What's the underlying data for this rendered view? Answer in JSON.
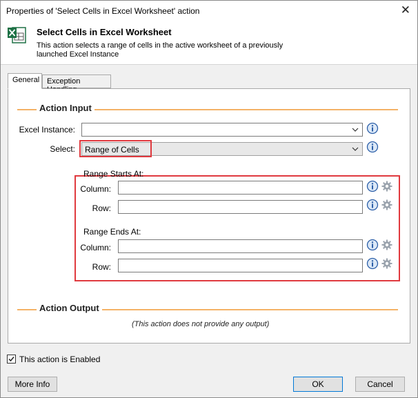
{
  "window": {
    "title": "Properties of 'Select Cells in Excel Worksheet' action",
    "close_glyph": "✕"
  },
  "header": {
    "icon": "excel-icon",
    "title": "Select Cells in Excel Worksheet",
    "description": "This action selects a range of cells in the active worksheet of a previously launched Excel Instance"
  },
  "tabs": [
    {
      "label": "General",
      "active": true
    },
    {
      "label": "Exception Handling",
      "active": false
    }
  ],
  "action_input": {
    "section_title": "Action Input",
    "excel_instance": {
      "label": "Excel Instance:",
      "value": ""
    },
    "select": {
      "label": "Select:",
      "value": "Range of Cells"
    },
    "range_start": {
      "label": "Range Starts At:",
      "column": {
        "label": "Column:",
        "value": ""
      },
      "row": {
        "label": "Row:",
        "value": ""
      }
    },
    "range_end": {
      "label": "Range Ends At:",
      "column": {
        "label": "Column:",
        "value": ""
      },
      "row": {
        "label": "Row:",
        "value": ""
      }
    }
  },
  "action_output": {
    "section_title": "Action Output",
    "message": "(This action does not provide any output)"
  },
  "enabled": {
    "label": "This action is Enabled",
    "checked": true
  },
  "buttons": {
    "more_info": "More Info",
    "ok": "OK",
    "cancel": "Cancel"
  },
  "colors": {
    "highlight": "#e0393e",
    "section_line": "#f4b266",
    "excel_green": "#1e7145"
  }
}
